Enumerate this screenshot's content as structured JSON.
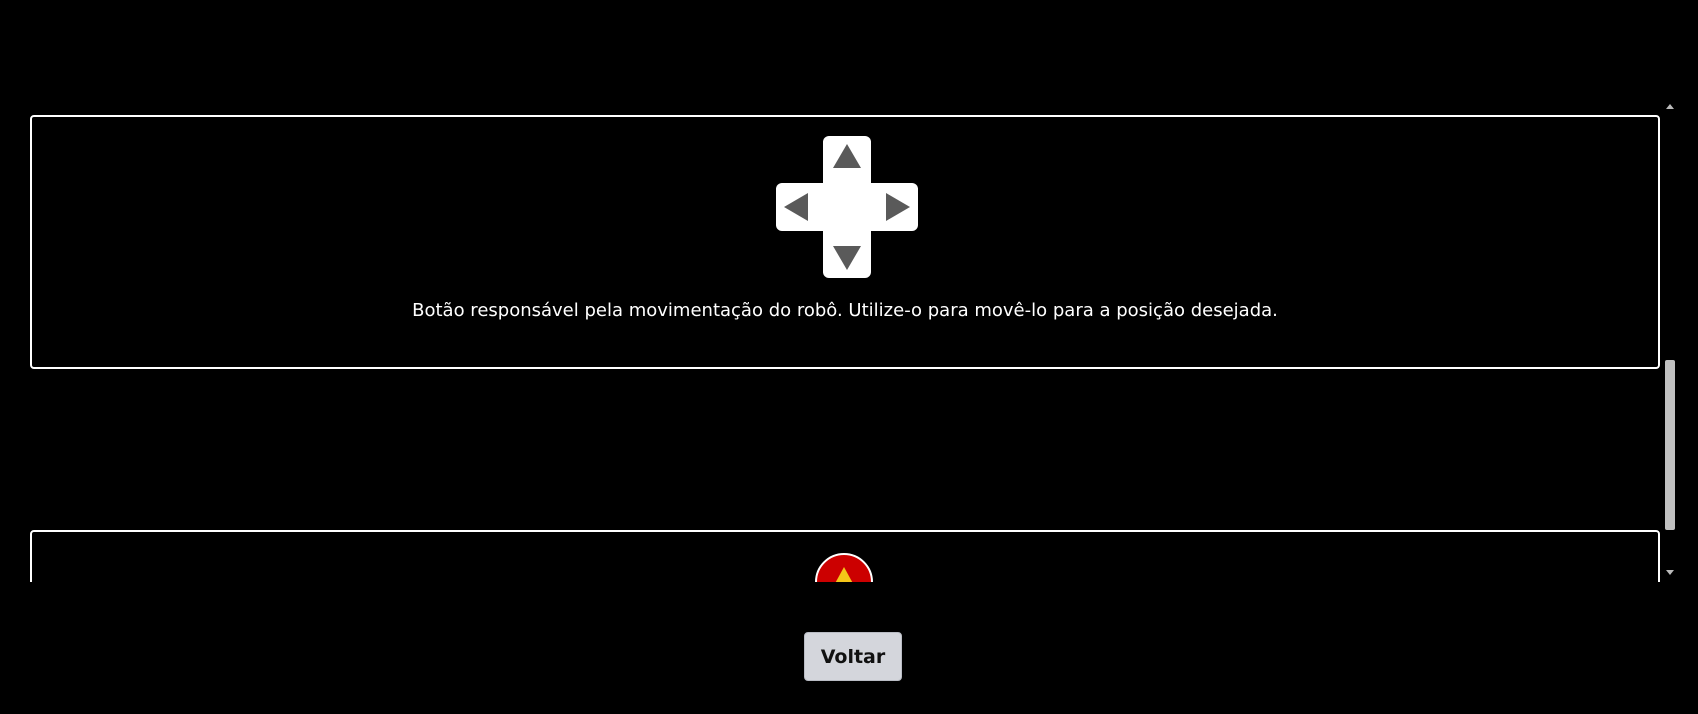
{
  "movement_card": {
    "description": "Botão responsável pela movimentação do robô. Utilize-o para movê-lo para a posição desejada.",
    "icon": "dpad-icon"
  },
  "emergency_card": {
    "icon": "warning-icon"
  },
  "footer": {
    "back_label": "Voltar"
  },
  "colors": {
    "background": "#000000",
    "card_border": "#ffffff",
    "dpad_fill": "#ffffff",
    "dpad_arrow": "#5a5a5a",
    "emergency_red": "#cc0000",
    "warning_yellow": "#f5c518",
    "button_bg": "#d4d6dc"
  }
}
